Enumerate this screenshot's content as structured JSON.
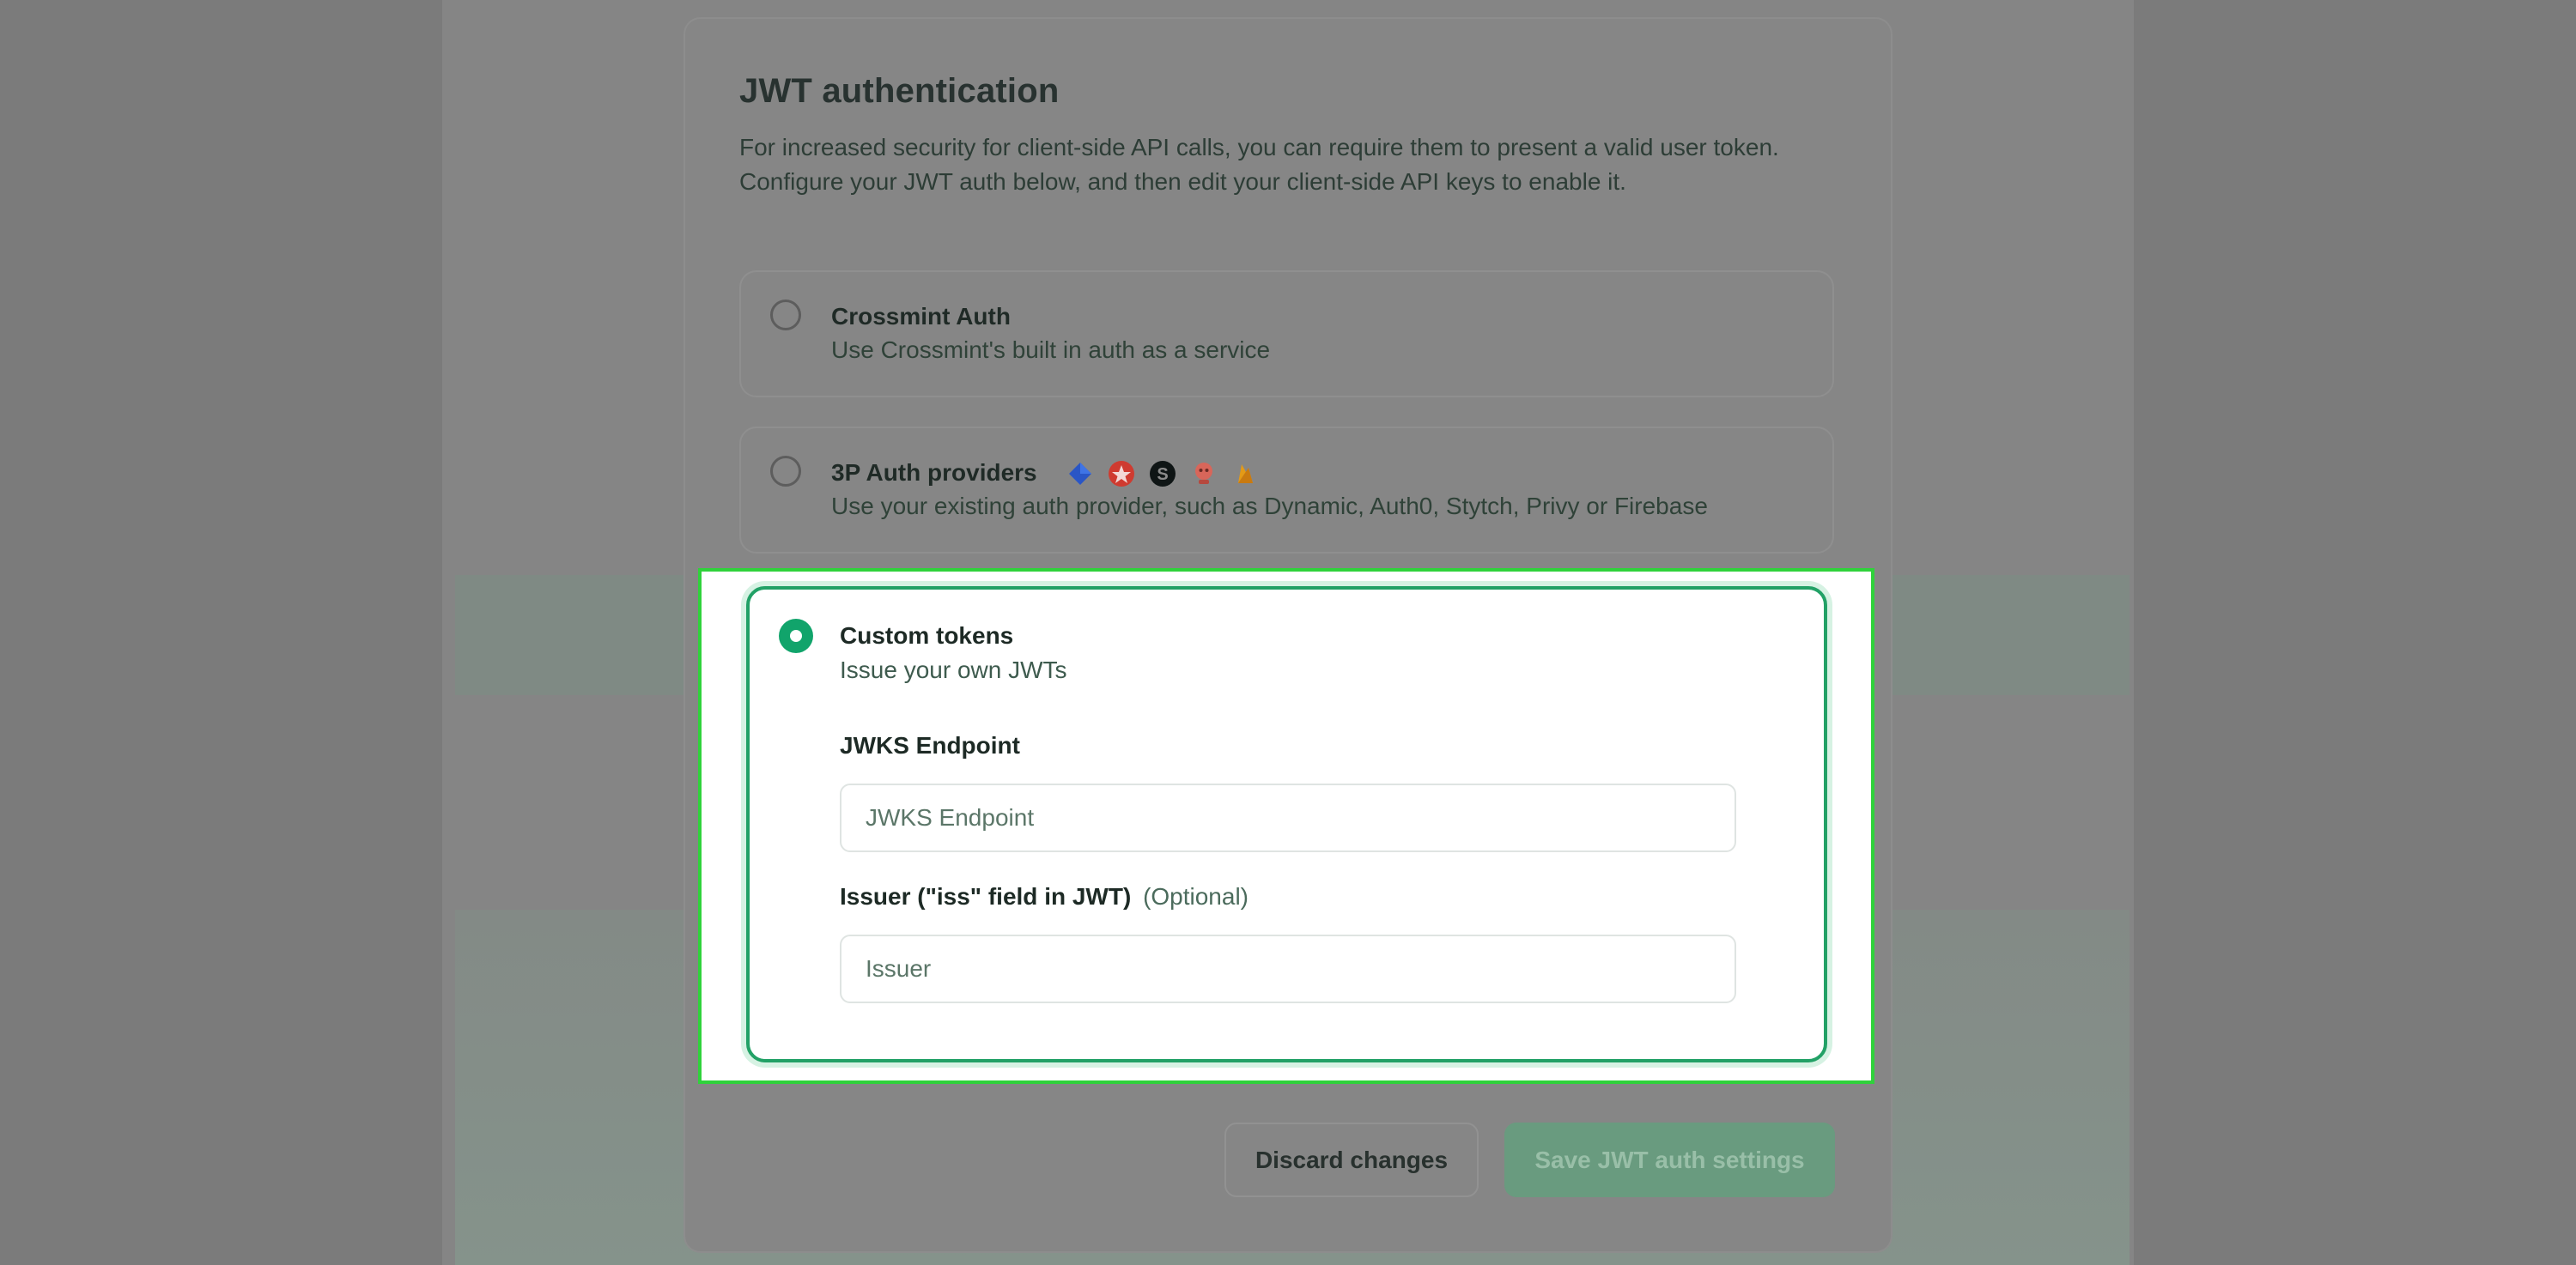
{
  "page": {
    "title": "JWT authentication",
    "description_lines": [
      "For increased security for client-side API calls, you can require them to present a valid user token.",
      "Configure your JWT auth below, and then edit your client-side API keys to enable it."
    ]
  },
  "options": [
    {
      "title": "Crossmint Auth",
      "subtitle": "Use Crossmint's built in auth as a service",
      "selected": false
    },
    {
      "title": "3P Auth providers",
      "subtitle": "Use your existing auth provider, such as Dynamic, Auth0, Stytch, Privy or Firebase",
      "selected": false,
      "provider_icons": [
        "dynamic-icon",
        "auth0-icon",
        "stytch-icon",
        "privy-icon",
        "firebase-icon"
      ]
    },
    {
      "title": "Custom tokens",
      "subtitle": "Issue your own JWTs",
      "selected": true
    }
  ],
  "custom_form": {
    "jwks": {
      "label": "JWKS Endpoint",
      "placeholder": "JWKS Endpoint",
      "value": ""
    },
    "issuer": {
      "label": "Issuer (\"iss\" field in JWT)",
      "optional_tag": "(Optional)",
      "placeholder": "Issuer",
      "value": ""
    }
  },
  "actions": {
    "discard_label": "Discard changes",
    "save_label": "Save JWT auth settings"
  },
  "colors": {
    "accent": "#11a46b",
    "highlight": "#2fd23b",
    "save_disabled": "#699b7f"
  }
}
